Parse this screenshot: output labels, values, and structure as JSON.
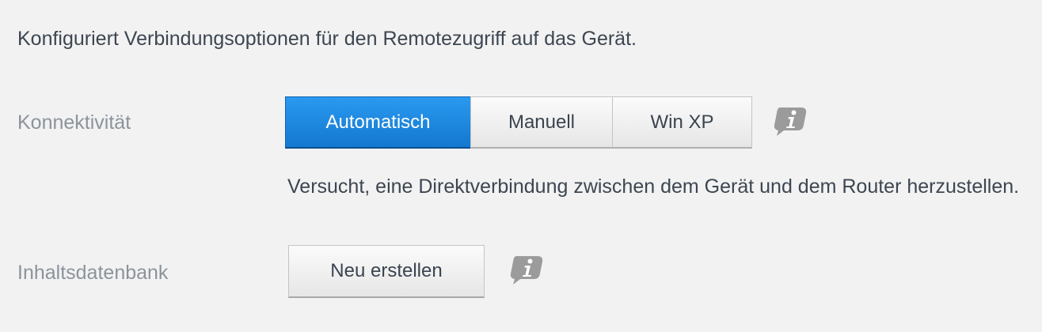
{
  "intro_text": "Konfiguriert Verbindungsoptionen für den Remotezugriff auf das Gerät.",
  "connectivity": {
    "label": "Konnektivität",
    "options": [
      "Automatisch",
      "Manuell",
      "Win XP"
    ],
    "selected": "Automatisch",
    "info_icon": "info-speech-bubble-icon",
    "description": "Versucht, eine Direktverbindung zwischen dem Gerät und dem Router herzustellen."
  },
  "content_db": {
    "label": "Inhaltsdatenbank",
    "button_label": "Neu erstellen",
    "info_icon": "info-speech-bubble-icon"
  },
  "colors": {
    "accent": "#1e88e5",
    "background": "#f2f2f2",
    "label_gray": "#8c939b",
    "text_dark": "#3d4651",
    "icon_gray": "#9b9b9b"
  }
}
